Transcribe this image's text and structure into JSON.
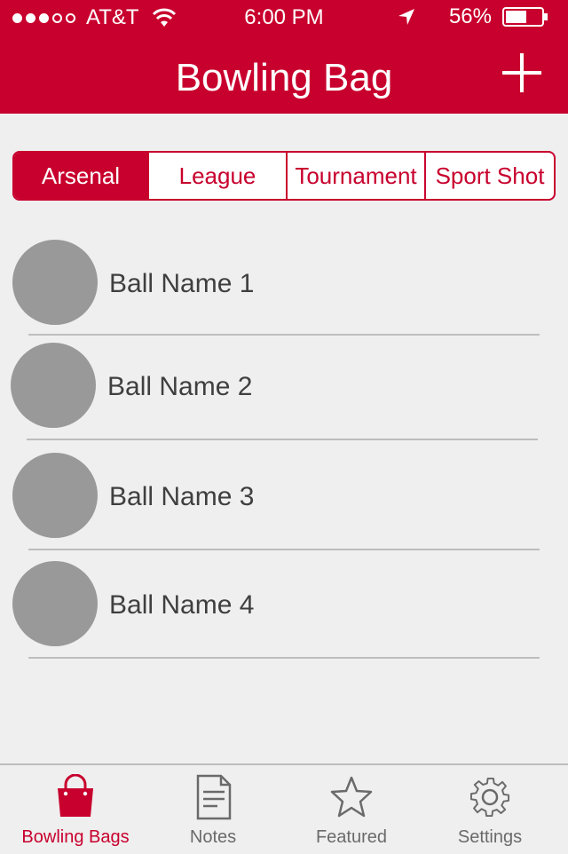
{
  "status_bar": {
    "carrier": "AT&T",
    "time": "6:00 PM",
    "battery": "56%"
  },
  "header": {
    "title": "Bowling Bag",
    "add_label": "+"
  },
  "segments": [
    {
      "label": "Arsenal",
      "active": true
    },
    {
      "label": "League",
      "active": false
    },
    {
      "label": "Tournament",
      "active": false
    },
    {
      "label": "Sport Shot",
      "active": false
    }
  ],
  "balls": [
    {
      "name": "Ball Name 1"
    },
    {
      "name": "Ball Name 2"
    },
    {
      "name": "Ball Name 3"
    },
    {
      "name": "Ball Name 4"
    }
  ],
  "tabbar": {
    "tabs": [
      {
        "label": "Bowling Bags",
        "icon": "shopping-bag-icon",
        "active": true
      },
      {
        "label": "Notes",
        "icon": "document-icon",
        "active": false
      },
      {
        "label": "Featured",
        "icon": "star-icon",
        "active": false
      },
      {
        "label": "Settings",
        "icon": "gear-icon",
        "active": false
      }
    ]
  },
  "colors": {
    "brand": "#c8002d",
    "background": "#efefef",
    "avatar": "#999999",
    "tab_inactive": "#6a6a6a"
  }
}
